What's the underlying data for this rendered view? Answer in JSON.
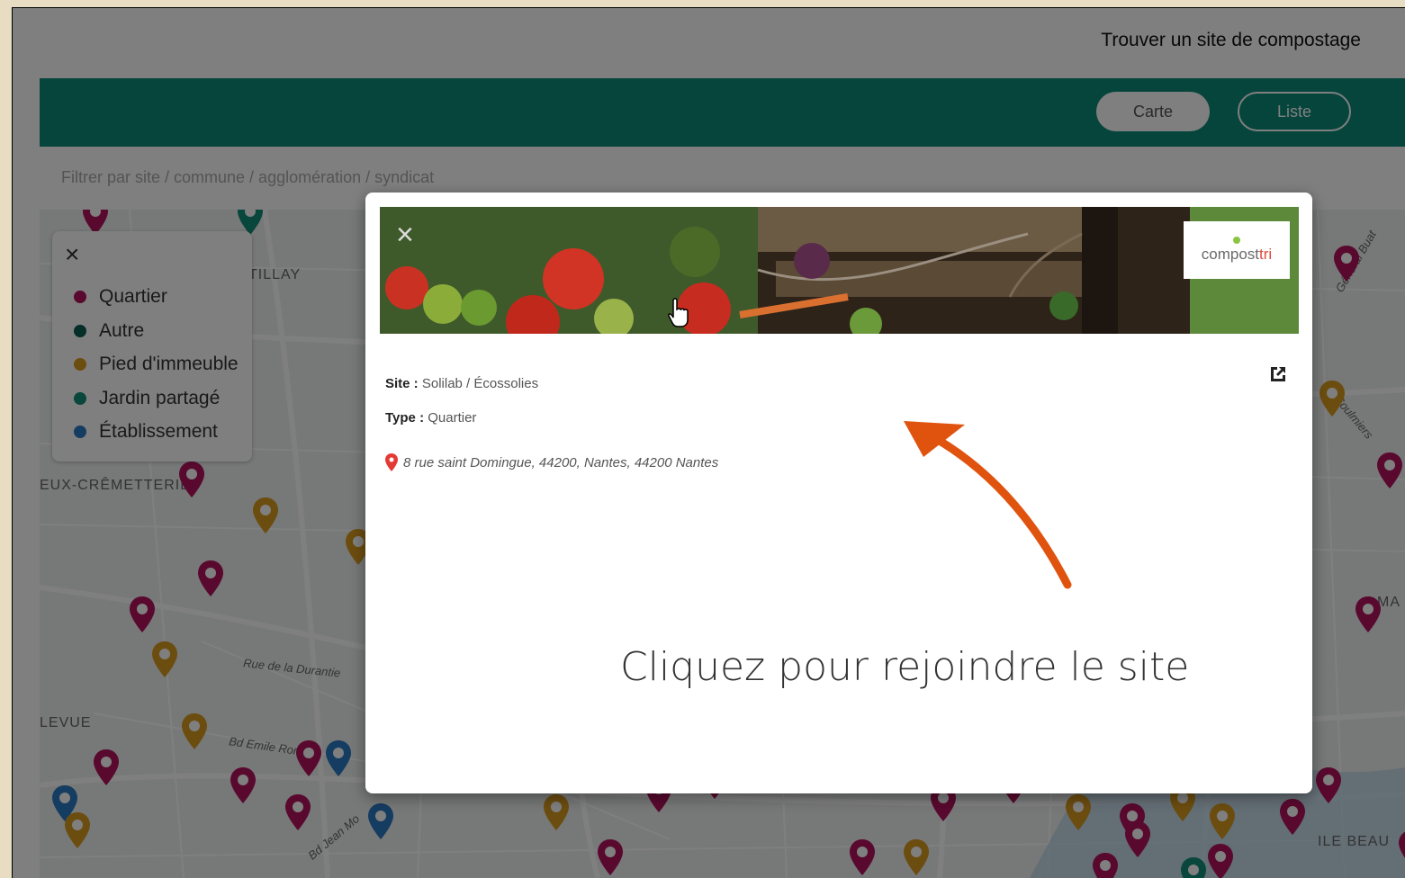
{
  "header": {
    "title": "Trouver un site de compostage"
  },
  "view_toggle": {
    "map_label": "Carte",
    "list_label": "Liste"
  },
  "filter": {
    "placeholder": "Filtrer par site / commune / agglomération / syndicat"
  },
  "legend": {
    "items": [
      {
        "label": "Quartier",
        "color": "#b3135d"
      },
      {
        "label": "Autre",
        "color": "#0a5c4f"
      },
      {
        "label": "Pied d'immeuble",
        "color": "#d99a20"
      },
      {
        "label": "Jardin partagé",
        "color": "#138c77"
      },
      {
        "label": "Établissement",
        "color": "#2a78c2"
      }
    ]
  },
  "map": {
    "place_labels": [
      "TILLAY",
      "EUX-CRÊMETTERIE",
      "LEVUE",
      "MA",
      "ILE BEAU"
    ],
    "street_labels": [
      "Rue de la Durantie",
      "Bd Emile Roman",
      "Bd Jean Mo",
      "Général Buat",
      "de Coulmiers"
    ]
  },
  "modal": {
    "logo_text_a": "compost",
    "logo_text_b": "tri",
    "site_label": "Site :",
    "site_value": "Solilab / Écossolies",
    "type_label": "Type :",
    "type_value": "Quartier",
    "address": "8 rue saint Domingue, 44200, Nantes, 44200 Nantes"
  },
  "annotation": {
    "text": "Cliquez pour rejoindre le site",
    "arrow_color": "#e0530f"
  },
  "colors": {
    "brand_green": "#0b8a78",
    "accent_orange": "#e0530f"
  }
}
